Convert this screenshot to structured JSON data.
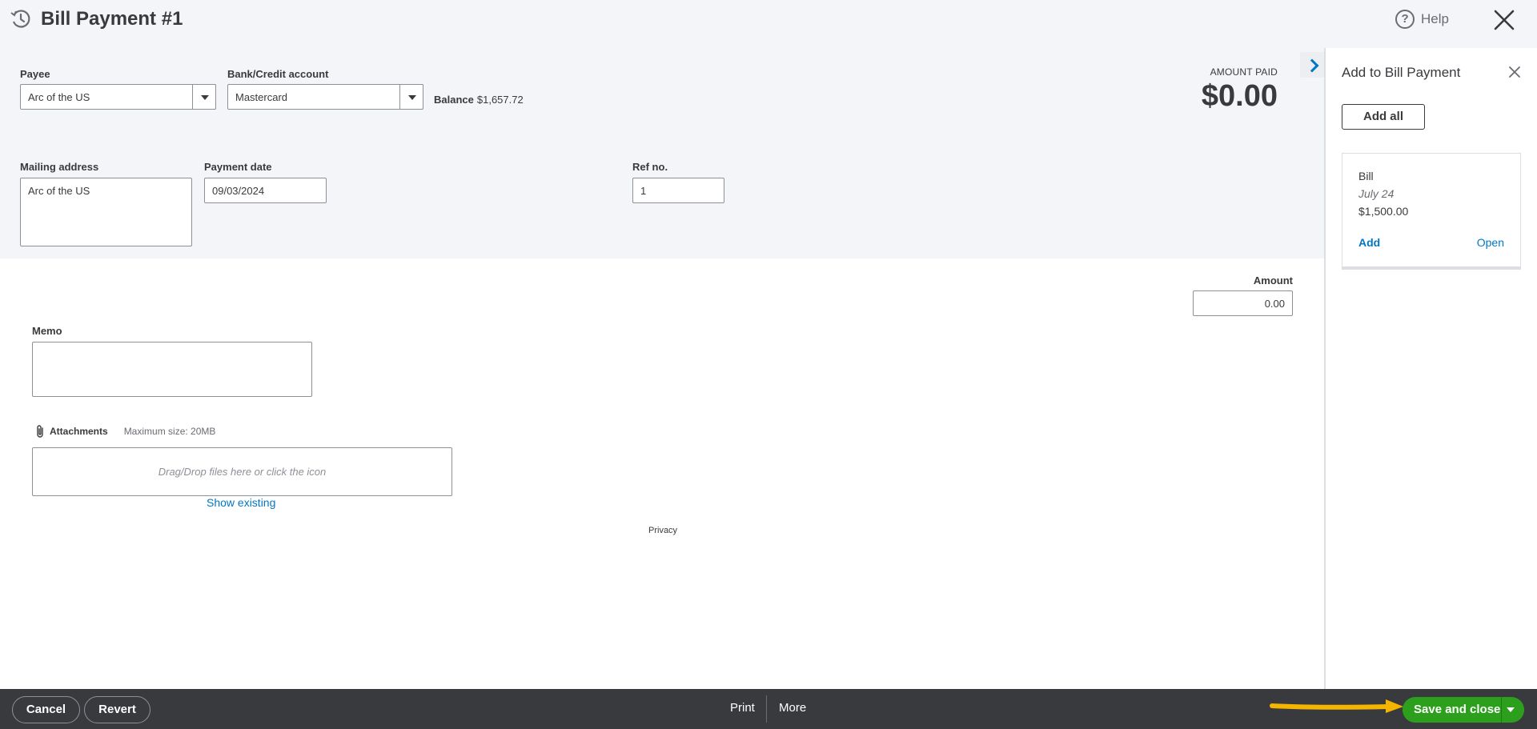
{
  "header": {
    "title": "Bill Payment #1",
    "help_label": "Help"
  },
  "form": {
    "payee_label": "Payee",
    "payee_value": "Arc of the US",
    "account_label": "Bank/Credit account",
    "account_value": "Mastercard",
    "balance_label": "Balance",
    "balance_value": "$1,657.72",
    "amount_paid_label": "AMOUNT PAID",
    "amount_paid_value": "$0.00",
    "mailing_label": "Mailing address",
    "mailing_value": "Arc of the US",
    "payment_date_label": "Payment date",
    "payment_date_value": "09/03/2024",
    "ref_label": "Ref no.",
    "ref_value": "1"
  },
  "body": {
    "amount_label": "Amount",
    "amount_value": "0.00",
    "memo_label": "Memo",
    "memo_value": "",
    "attachments_label": "Attachments",
    "max_size": "Maximum size: 20MB",
    "dropzone_text": "Drag/Drop files here or click the icon",
    "show_existing": "Show existing",
    "privacy": "Privacy"
  },
  "side_panel": {
    "title": "Add to Bill Payment",
    "add_all": "Add all",
    "bills": [
      {
        "type": "Bill",
        "date": "July 24",
        "amount": "$1,500.00",
        "add_label": "Add",
        "open_label": "Open"
      }
    ]
  },
  "footer": {
    "cancel": "Cancel",
    "revert": "Revert",
    "print": "Print",
    "more": "More",
    "save_close": "Save and close"
  },
  "colors": {
    "accent_green": "#2ca01c",
    "link_blue": "#0077c5",
    "footer_bg": "#393a3d",
    "annotation_arrow": "#f4b400"
  }
}
